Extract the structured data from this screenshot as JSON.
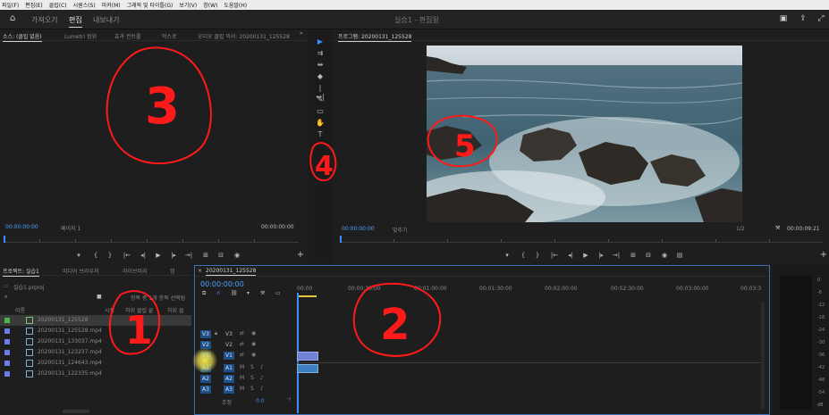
{
  "menu": [
    "파일(F)",
    "편집(E)",
    "클립(C)",
    "시퀀스(S)",
    "마커(M)",
    "그래픽 및 타이틀(G)",
    "보기(V)",
    "창(W)",
    "도움말(H)"
  ],
  "workspace": {
    "tabs": [
      "가져오기",
      "편집",
      "내보내기"
    ],
    "active_tab": "편집",
    "title": "실습1 - 편집됨"
  },
  "source_panel": {
    "tabs": [
      "소스: (클립 없음)",
      "Lumetri 범위",
      "효과 컨트롤",
      "믹스로",
      "오디오 클립 믹서: 20200131_125528"
    ],
    "timecode_in": "00:00:00:00",
    "page_label": "페이지 1",
    "timecode_out": "00:00:00:00"
  },
  "program_panel": {
    "tab": "프로그램: 20200131_125528",
    "timecode_in": "00:00:00:00",
    "fit_label": "맞추기",
    "resolution": "1/2",
    "timecode_out": "00:00:09:21"
  },
  "project_panel": {
    "tabs": [
      "프로젝트: 실습1",
      "미디어 브라우저",
      "라이브러리",
      "정"
    ],
    "project_file": "실습1.prproj",
    "selection_hint": "항목 중 1개 항목 선택됨",
    "columns": [
      "이름",
      "시작",
      "하위 클립 끝",
      "하위 클"
    ],
    "items": [
      {
        "name": "20200131_125528",
        "color": "#4cb84c",
        "type": "sequence"
      },
      {
        "name": "20200131_125528.mp4",
        "color": "#6b7ce8",
        "type": "clip"
      },
      {
        "name": "20200131_133037.mp4",
        "color": "#6b7ce8",
        "type": "clip"
      },
      {
        "name": "20200131_123237.mp4",
        "color": "#6b7ce8",
        "type": "clip"
      },
      {
        "name": "20200131_124643.mp4",
        "color": "#6b7ce8",
        "type": "clip"
      },
      {
        "name": "20200131_122335.mp4",
        "color": "#6b7ce8",
        "type": "clip"
      }
    ]
  },
  "timeline": {
    "sequence_tab": "20200131_125528",
    "timecode": "00:00:00:00",
    "ruler": [
      "00:00",
      "00:00:30:00",
      "00:01:00:00",
      "00:01:30:00",
      "00:02:00:00",
      "00:02:30:00",
      "00:03:00:00",
      "00:03:3"
    ],
    "video_tracks": [
      "V3",
      "V2",
      "V1"
    ],
    "audio_tracks": [
      "A1",
      "A2",
      "A3"
    ],
    "mix_label": "조정",
    "mix_value": "0.0"
  },
  "meter_scale": [
    "0",
    "-6",
    "-12",
    "-18",
    "-24",
    "-30",
    "-36",
    "-42",
    "-48",
    "-54",
    "dB"
  ],
  "annotations": [
    "3",
    "2",
    "1",
    "4",
    "5"
  ]
}
